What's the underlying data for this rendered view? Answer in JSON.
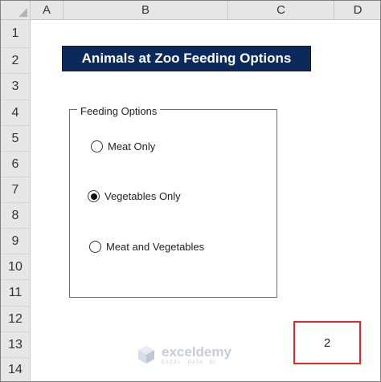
{
  "columns": [
    "A",
    "B",
    "C",
    "D"
  ],
  "rows": [
    "1",
    "2",
    "3",
    "4",
    "5",
    "6",
    "7",
    "8",
    "9",
    "10",
    "11",
    "12",
    "13",
    "14"
  ],
  "title": "Animals at Zoo Feeding Options",
  "group": {
    "label": "Feeding Options",
    "options": [
      {
        "label": "Meat Only",
        "selected": false
      },
      {
        "label": "Vegetables Only",
        "selected": true
      },
      {
        "label": "Meat and Vegetables",
        "selected": false
      }
    ]
  },
  "result_value": "2",
  "watermark": {
    "name": "exceldemy",
    "tagline": "EXCEL · DATA · BI"
  }
}
